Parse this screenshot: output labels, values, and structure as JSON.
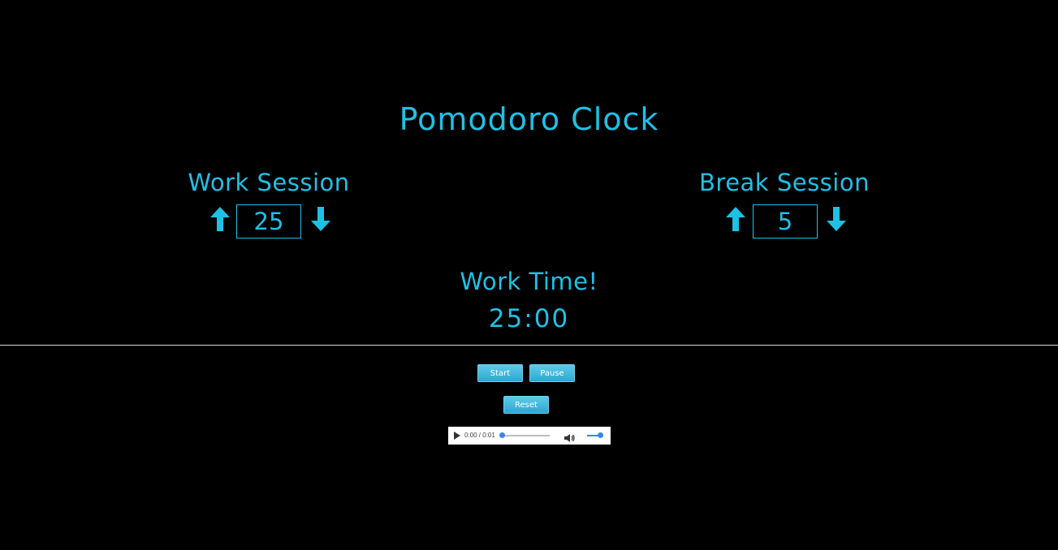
{
  "app": {
    "title": "Pomodoro Clock"
  },
  "work_session": {
    "label": "Work Session",
    "value": "25",
    "up_icon": "arrow-up-icon",
    "down_icon": "arrow-down-icon"
  },
  "break_session": {
    "label": "Break Session",
    "value": "5",
    "up_icon": "arrow-up-icon",
    "down_icon": "arrow-down-icon"
  },
  "timer": {
    "phase_label": "Work Time!",
    "time": "25:00"
  },
  "controls": {
    "start_label": "Start",
    "pause_label": "Pause",
    "reset_label": "Reset"
  },
  "audio": {
    "time_text": "0:00 / 0:01",
    "play_icon": "play-icon",
    "volume_icon": "volume-icon",
    "progress": 0,
    "volume": 1
  },
  "colors": {
    "background": "#000000",
    "accent": "#1ec1e6",
    "button": "#2fa6d2"
  }
}
